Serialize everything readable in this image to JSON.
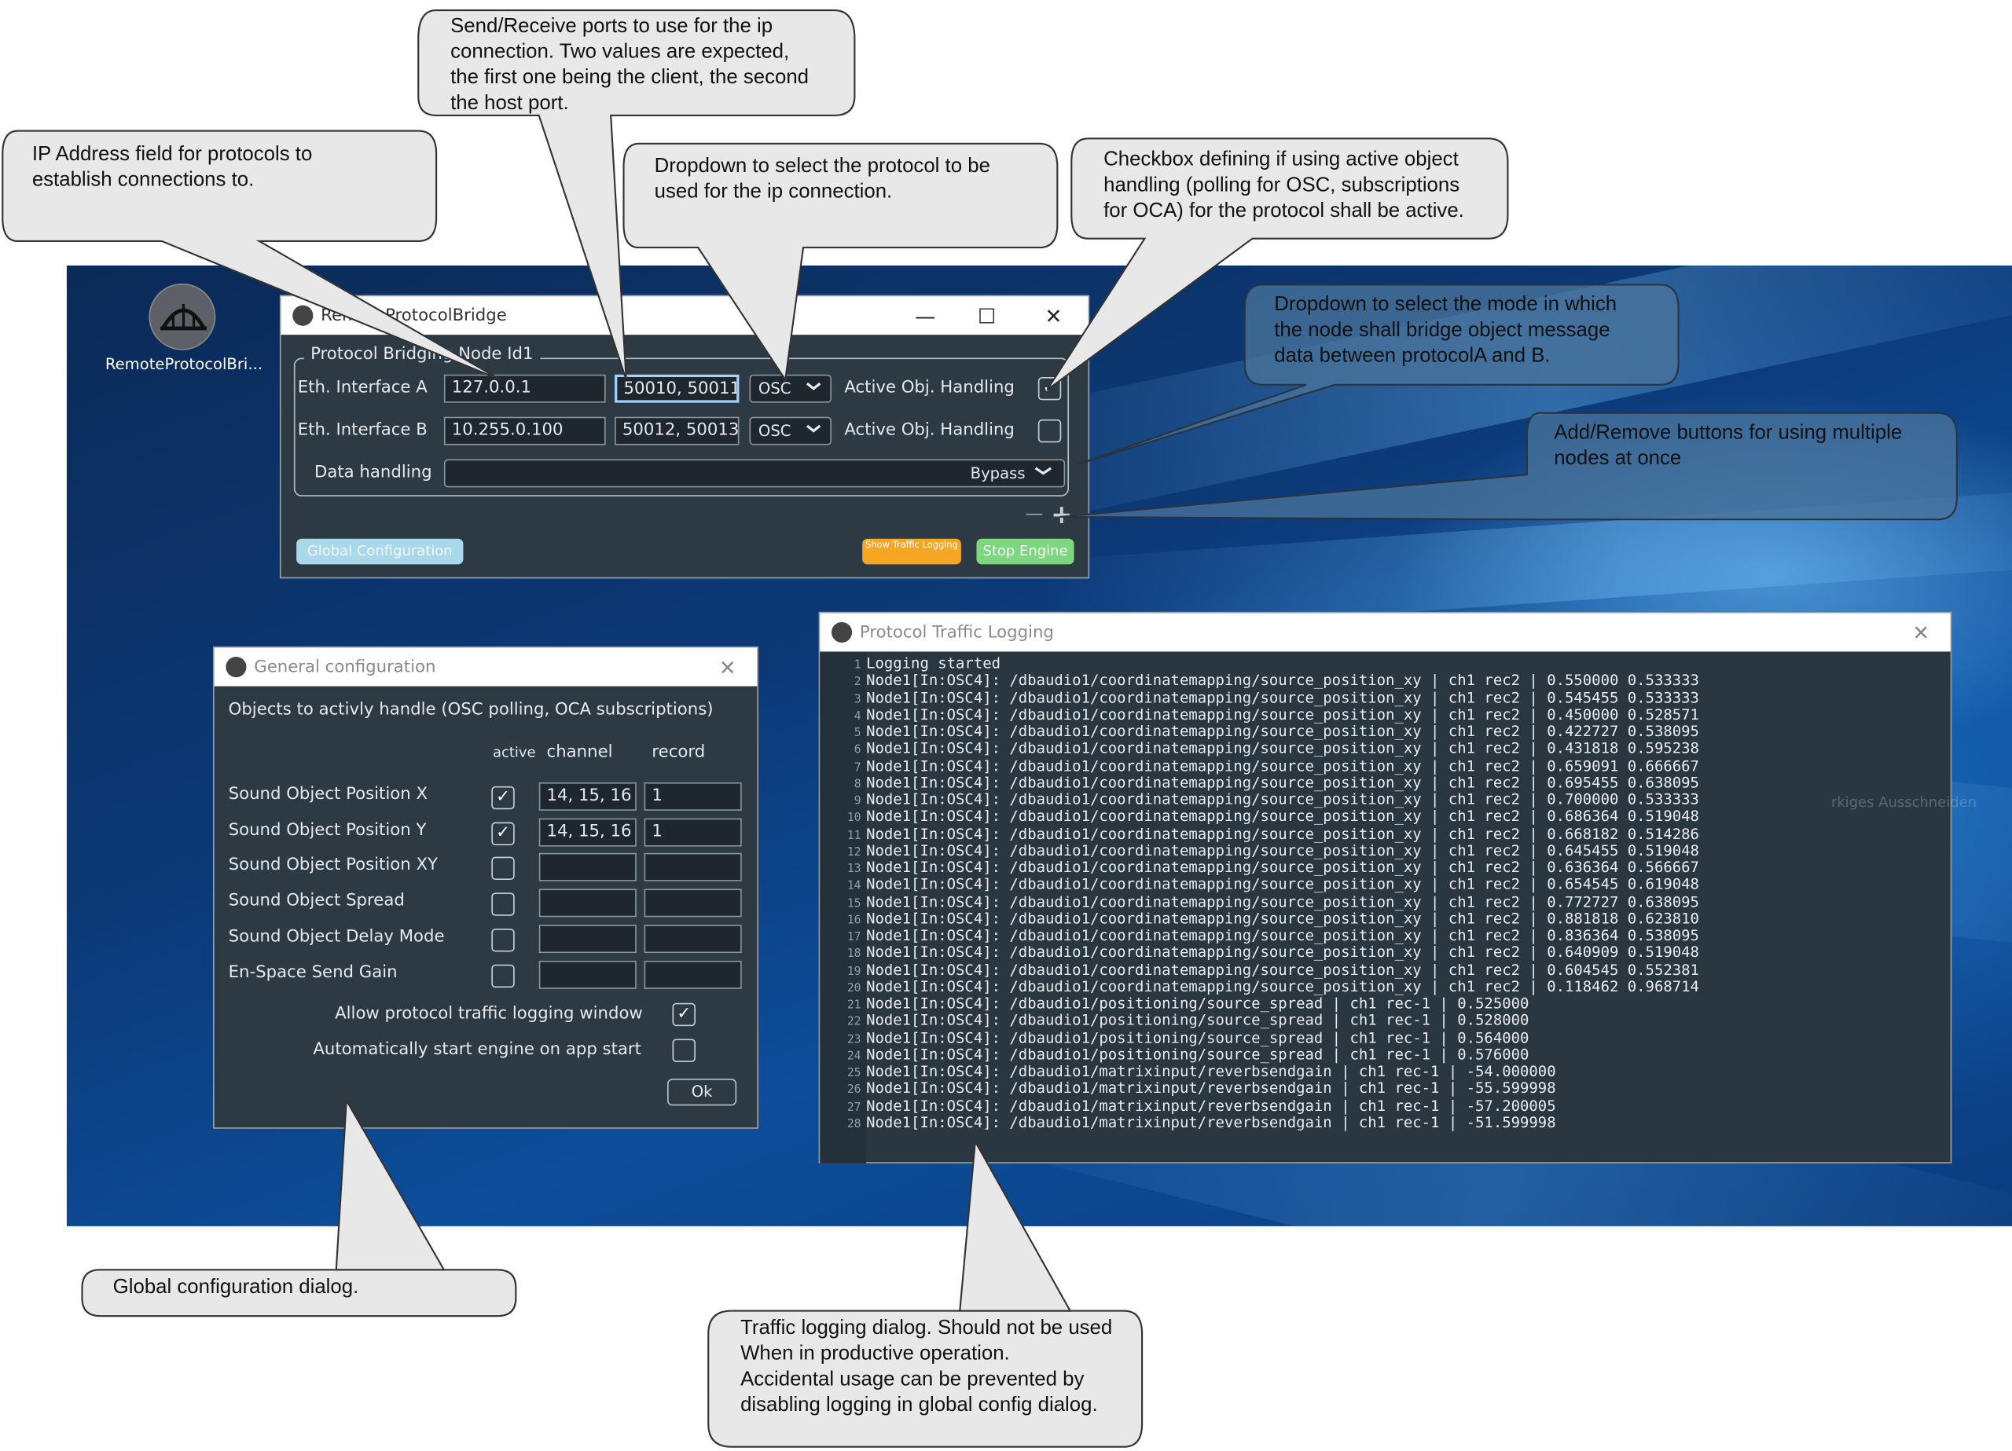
{
  "desktop": {
    "icon_label": "RemoteProtocolBri..."
  },
  "main_window": {
    "title": "RemoteProtocolBridge",
    "minimize": "—",
    "maximize": "☐",
    "close": "✕",
    "group_title": "Protocol Bridging Node Id1",
    "rows": [
      {
        "label": "Eth. Interface A",
        "ip": "127.0.0.1",
        "ports": "50010, 50011",
        "protocol": "OSC",
        "active_label": "Active Obj. Handling",
        "active": true
      },
      {
        "label": "Eth. Interface B",
        "ip": "10.255.0.100",
        "ports": "50012, 50013",
        "protocol": "OSC",
        "active_label": "Active Obj. Handling",
        "active": false
      }
    ],
    "data_handling_label": "Data handling",
    "data_handling_value": "Bypass",
    "remove_node": "—",
    "add_node": "+",
    "global_config_button": "Global Configuration",
    "show_traffic_button": "Show Traffic Logging",
    "stop_engine_button": "Stop Engine",
    "colors": {
      "global_config": "#a8d8ea",
      "show_traffic": "#f5a623",
      "stop_engine": "#7ed77e"
    }
  },
  "config_window": {
    "title": "General configuration",
    "close": "✕",
    "heading": "Objects to activly handle (OSC polling, OCA subscriptions)",
    "col_active": "active",
    "col_channel": "channel",
    "col_record": "record",
    "rows": [
      {
        "label": "Sound Object Position X",
        "active": true,
        "channel": "14, 15, 16",
        "record": "1"
      },
      {
        "label": "Sound Object Position Y",
        "active": true,
        "channel": "14, 15, 16",
        "record": "1"
      },
      {
        "label": "Sound Object Position XY",
        "active": false,
        "channel": "",
        "record": ""
      },
      {
        "label": "Sound Object Spread",
        "active": false,
        "channel": "",
        "record": ""
      },
      {
        "label": "Sound Object Delay Mode",
        "active": false,
        "channel": "",
        "record": ""
      },
      {
        "label": "En-Space Send Gain",
        "active": false,
        "channel": "",
        "record": ""
      }
    ],
    "allow_logging_label": "Allow protocol traffic logging window",
    "allow_logging": true,
    "autostart_label": "Automatically start engine on app start",
    "autostart": false,
    "ok": "Ok"
  },
  "log_window": {
    "title": "Protocol Traffic Logging",
    "close": "✕",
    "lines": [
      "Logging started",
      "Node1[In:OSC4]: /dbaudio1/coordinatemapping/source_position_xy | ch1 rec2 | 0.550000 0.533333",
      "Node1[In:OSC4]: /dbaudio1/coordinatemapping/source_position_xy | ch1 rec2 | 0.545455 0.533333",
      "Node1[In:OSC4]: /dbaudio1/coordinatemapping/source_position_xy | ch1 rec2 | 0.450000 0.528571",
      "Node1[In:OSC4]: /dbaudio1/coordinatemapping/source_position_xy | ch1 rec2 | 0.422727 0.538095",
      "Node1[In:OSC4]: /dbaudio1/coordinatemapping/source_position_xy | ch1 rec2 | 0.431818 0.595238",
      "Node1[In:OSC4]: /dbaudio1/coordinatemapping/source_position_xy | ch1 rec2 | 0.659091 0.666667",
      "Node1[In:OSC4]: /dbaudio1/coordinatemapping/source_position_xy | ch1 rec2 | 0.695455 0.638095",
      "Node1[In:OSC4]: /dbaudio1/coordinatemapping/source_position_xy | ch1 rec2 | 0.700000 0.533333",
      "Node1[In:OSC4]: /dbaudio1/coordinatemapping/source_position_xy | ch1 rec2 | 0.686364 0.519048",
      "Node1[In:OSC4]: /dbaudio1/coordinatemapping/source_position_xy | ch1 rec2 | 0.668182 0.514286",
      "Node1[In:OSC4]: /dbaudio1/coordinatemapping/source_position_xy | ch1 rec2 | 0.645455 0.519048",
      "Node1[In:OSC4]: /dbaudio1/coordinatemapping/source_position_xy | ch1 rec2 | 0.636364 0.566667",
      "Node1[In:OSC4]: /dbaudio1/coordinatemapping/source_position_xy | ch1 rec2 | 0.654545 0.619048",
      "Node1[In:OSC4]: /dbaudio1/coordinatemapping/source_position_xy | ch1 rec2 | 0.772727 0.638095",
      "Node1[In:OSC4]: /dbaudio1/coordinatemapping/source_position_xy | ch1 rec2 | 0.881818 0.623810",
      "Node1[In:OSC4]: /dbaudio1/coordinatemapping/source_position_xy | ch1 rec2 | 0.836364 0.538095",
      "Node1[In:OSC4]: /dbaudio1/coordinatemapping/source_position_xy | ch1 rec2 | 0.640909 0.519048",
      "Node1[In:OSC4]: /dbaudio1/coordinatemapping/source_position_xy | ch1 rec2 | 0.604545 0.552381",
      "Node1[In:OSC4]: /dbaudio1/coordinatemapping/source_position_xy | ch1 rec2 | 0.118462 0.968714",
      "Node1[In:OSC4]: /dbaudio1/positioning/source_spread | ch1 rec-1 | 0.525000",
      "Node1[In:OSC4]: /dbaudio1/positioning/source_spread | ch1 rec-1 | 0.528000",
      "Node1[In:OSC4]: /dbaudio1/positioning/source_spread | ch1 rec-1 | 0.564000",
      "Node1[In:OSC4]: /dbaudio1/positioning/source_spread | ch1 rec-1 | 0.576000",
      "Node1[In:OSC4]: /dbaudio1/matrixinput/reverbsendgain | ch1 rec-1 | -54.000000",
      "Node1[In:OSC4]: /dbaudio1/matrixinput/reverbsendgain | ch1 rec-1 | -55.599998",
      "Node1[In:OSC4]: /dbaudio1/matrixinput/reverbsendgain | ch1 rec-1 | -57.200005",
      "Node1[In:OSC4]: /dbaudio1/matrixinput/reverbsendgain | ch1 rec-1 | -51.599998"
    ],
    "background_fragment": "rkiges Ausschneiden"
  },
  "callouts": {
    "ports": "Send/Receive ports to use for the ip\nconnection. Two values are expected,\nthe first one being the client, the second\nthe host port.",
    "ip": "IP Address field for protocols to\nestablish connections to.",
    "protocol": "Dropdown to select the protocol to be\nused for the ip connection.",
    "active": "Checkbox defining if using active object\nhandling (polling for OSC, subscriptions\nfor OCA) for the protocol shall be active.",
    "mode": "Dropdown to select the mode in which\nthe node shall bridge object message\ndata between protocolA and B.",
    "addremove": "Add/Remove buttons for using multiple\nnodes at once",
    "global": "Global configuration dialog.",
    "traffic": "Traffic logging dialog. Should not be used\nWhen in productive operation.\nAccidental usage can be prevented by\ndisabling logging in global config dialog."
  }
}
